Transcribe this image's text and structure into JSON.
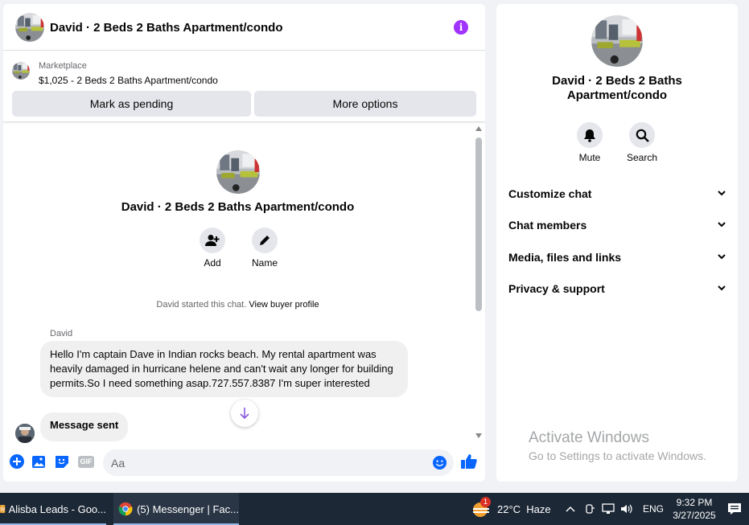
{
  "chat": {
    "title": "David · 2 Beds 2 Baths Apartment/condo",
    "info_icon": "i",
    "marketplace_label": "Marketplace",
    "listing": "$1,025 - 2 Beds 2 Baths Apartment/condo",
    "btn_pending": "Mark as pending",
    "btn_more": "More options"
  },
  "thread": {
    "title": "David · 2 Beds 2 Baths Apartment/condo",
    "add_label": "Add",
    "name_label": "Name",
    "started_text": "David started this chat.",
    "view_profile": "View buyer profile",
    "sender": "David",
    "message": "Hello I'm captain Dave in Indian rocks beach. My rental apartment was heavily damaged in hurricane helene and can't wait any longer for building permits.So I need something asap.727.557.8387 I'm super interested",
    "sent_message": "Message sent"
  },
  "composer": {
    "placeholder": "Aa",
    "gif": "GIF"
  },
  "info": {
    "title": "David · 2 Beds 2 Baths Apartment/condo",
    "mute_label": "Mute",
    "search_label": "Search",
    "sections": [
      "Customize chat",
      "Chat members",
      "Media, files and links",
      "Privacy & support"
    ],
    "activate_title": "Activate Windows",
    "activate_sub": "Go to Settings to activate Windows."
  },
  "taskbar": {
    "app1": "Alisba Leads - Goo...",
    "app2": "(5) Messenger | Fac...",
    "badge": "1",
    "weather": "22°C  Haze",
    "lang": "ENG",
    "time": "9:32 PM",
    "date": "3/27/2025"
  },
  "colors": {
    "accent": "#0866ff",
    "info_purple": "#a033ff",
    "taskbar": "#1c2836"
  }
}
